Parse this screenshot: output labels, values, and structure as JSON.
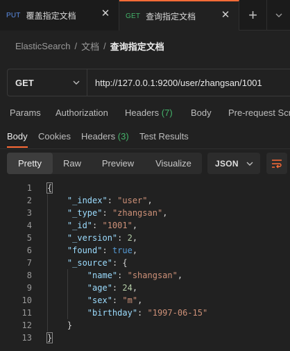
{
  "tabs": [
    {
      "method": "PUT",
      "title": "覆盖指定文档",
      "active": false
    },
    {
      "method": "GET",
      "title": "查询指定文档",
      "active": true
    }
  ],
  "icons": {
    "close": "close-icon",
    "new_tab": "plus-icon",
    "tab_menu": "chevron-down-icon",
    "wrap": "wrap-lines-icon"
  },
  "breadcrumb": {
    "root": "ElasticSearch",
    "folder": "文档",
    "current": "查询指定文档",
    "separator": "/"
  },
  "request": {
    "method": "GET",
    "url": "http://127.0.0.1:9200/user/zhangsan/1001"
  },
  "request_tabs": [
    {
      "label": "Params"
    },
    {
      "label": "Authorization"
    },
    {
      "label": "Headers",
      "count": "(7)"
    },
    {
      "label": "Body"
    },
    {
      "label": "Pre-request Scr"
    }
  ],
  "response_tabs": [
    {
      "label": "Body",
      "active": true
    },
    {
      "label": "Cookies"
    },
    {
      "label": "Headers",
      "count": "(3)"
    },
    {
      "label": "Test Results"
    }
  ],
  "view_modes": [
    "Pretty",
    "Raw",
    "Preview",
    "Visualize"
  ],
  "active_view": "Pretty",
  "format": "JSON",
  "colors": {
    "accent": "#ff6c37",
    "get": "#44b36a",
    "put": "#5c8ee6",
    "count": "#44b36a"
  },
  "response_body": {
    "line_numbers": [
      "1",
      "2",
      "3",
      "4",
      "5",
      "6",
      "7",
      "8",
      "9",
      "10",
      "11",
      "12",
      "13"
    ],
    "lines": [
      "{",
      "    \"_index\": \"user\",",
      "    \"_type\": \"zhangsan\",",
      "    \"_id\": \"1001\",",
      "    \"_version\": 2,",
      "    \"found\": true,",
      "    \"_source\": {",
      "        \"name\": \"shangsan\",",
      "        \"age\": 24,",
      "        \"sex\": \"m\",",
      "        \"birthday\": \"1997-06-15\"",
      "    }",
      "}"
    ]
  }
}
